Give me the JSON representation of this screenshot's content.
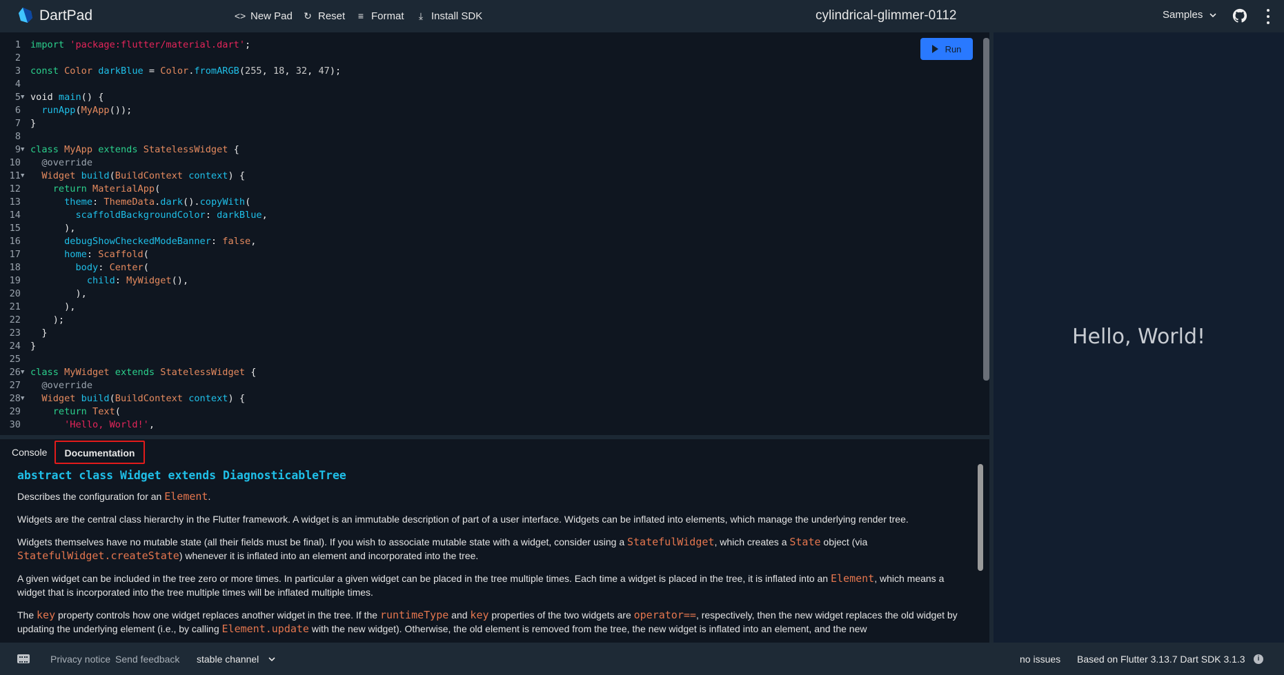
{
  "header": {
    "brand": "DartPad",
    "actions": [
      {
        "label": "New Pad",
        "icon": "code-icon"
      },
      {
        "label": "Reset",
        "icon": "refresh-icon"
      },
      {
        "label": "Format",
        "icon": "format-align-icon"
      },
      {
        "label": "Install SDK",
        "icon": "download-icon"
      }
    ],
    "pad_title": "cylindrical-glimmer-0112",
    "samples_label": "Samples",
    "github_icon": "github-icon",
    "menu_icon": "more-vert-icon"
  },
  "editor": {
    "run_label": "Run",
    "lines": [
      {
        "n": "1",
        "fold": false,
        "tokens": [
          [
            "kw",
            "import"
          ],
          [
            "pl",
            " "
          ],
          [
            "str",
            "'package:flutter/material.dart'"
          ],
          [
            "pl",
            ";"
          ]
        ]
      },
      {
        "n": "2",
        "fold": false,
        "tokens": []
      },
      {
        "n": "3",
        "fold": false,
        "tokens": [
          [
            "kw",
            "const"
          ],
          [
            "pl",
            " "
          ],
          [
            "ty",
            "Color"
          ],
          [
            "pl",
            " "
          ],
          [
            "id",
            "darkBlue"
          ],
          [
            "pl",
            " = "
          ],
          [
            "ty",
            "Color"
          ],
          [
            "pl",
            "."
          ],
          [
            "id",
            "fromARGB"
          ],
          [
            "pl",
            "("
          ],
          [
            "num",
            "255"
          ],
          [
            "pl",
            ", "
          ],
          [
            "num",
            "18"
          ],
          [
            "pl",
            ", "
          ],
          [
            "num",
            "32"
          ],
          [
            "pl",
            ", "
          ],
          [
            "num",
            "47"
          ],
          [
            "pl",
            ");"
          ]
        ]
      },
      {
        "n": "4",
        "fold": false,
        "tokens": []
      },
      {
        "n": "5",
        "fold": true,
        "tokens": [
          [
            "pl",
            "void "
          ],
          [
            "id",
            "main"
          ],
          [
            "pl",
            "() {"
          ]
        ]
      },
      {
        "n": "6",
        "fold": false,
        "tokens": [
          [
            "pl",
            "  "
          ],
          [
            "id",
            "runApp"
          ],
          [
            "pl",
            "("
          ],
          [
            "ty",
            "MyApp"
          ],
          [
            "pl",
            "());"
          ]
        ]
      },
      {
        "n": "7",
        "fold": false,
        "tokens": [
          [
            "pl",
            "}"
          ]
        ]
      },
      {
        "n": "8",
        "fold": false,
        "tokens": []
      },
      {
        "n": "9",
        "fold": true,
        "tokens": [
          [
            "kw",
            "class"
          ],
          [
            "pl",
            " "
          ],
          [
            "ty",
            "MyApp"
          ],
          [
            "pl",
            " "
          ],
          [
            "kw",
            "extends"
          ],
          [
            "pl",
            " "
          ],
          [
            "ty",
            "StatelessWidget"
          ],
          [
            "pl",
            " {"
          ]
        ]
      },
      {
        "n": "10",
        "fold": false,
        "tokens": [
          [
            "pl",
            "  "
          ],
          [
            "ann",
            "@override"
          ]
        ]
      },
      {
        "n": "11",
        "fold": true,
        "tokens": [
          [
            "pl",
            "  "
          ],
          [
            "ty",
            "Widget"
          ],
          [
            "pl",
            " "
          ],
          [
            "id",
            "build"
          ],
          [
            "pl",
            "("
          ],
          [
            "ty",
            "BuildContext"
          ],
          [
            "pl",
            " "
          ],
          [
            "id",
            "context"
          ],
          [
            "pl",
            ") {"
          ]
        ]
      },
      {
        "n": "12",
        "fold": false,
        "tokens": [
          [
            "pl",
            "    "
          ],
          [
            "kw",
            "return"
          ],
          [
            "pl",
            " "
          ],
          [
            "ty",
            "MaterialApp"
          ],
          [
            "pl",
            "("
          ]
        ]
      },
      {
        "n": "13",
        "fold": false,
        "tokens": [
          [
            "pl",
            "      "
          ],
          [
            "id",
            "theme"
          ],
          [
            "pl",
            ": "
          ],
          [
            "ty",
            "ThemeData"
          ],
          [
            "pl",
            "."
          ],
          [
            "id",
            "dark"
          ],
          [
            "pl",
            "()."
          ],
          [
            "id",
            "copyWith"
          ],
          [
            "pl",
            "("
          ]
        ]
      },
      {
        "n": "14",
        "fold": false,
        "tokens": [
          [
            "pl",
            "        "
          ],
          [
            "id",
            "scaffoldBackgroundColor"
          ],
          [
            "pl",
            ": "
          ],
          [
            "id",
            "darkBlue"
          ],
          [
            "pl",
            ","
          ]
        ]
      },
      {
        "n": "15",
        "fold": false,
        "tokens": [
          [
            "pl",
            "      ),"
          ]
        ]
      },
      {
        "n": "16",
        "fold": false,
        "tokens": [
          [
            "pl",
            "      "
          ],
          [
            "id",
            "debugShowCheckedModeBanner"
          ],
          [
            "pl",
            ": "
          ],
          [
            "ty",
            "false"
          ],
          [
            "pl",
            ","
          ]
        ]
      },
      {
        "n": "17",
        "fold": false,
        "tokens": [
          [
            "pl",
            "      "
          ],
          [
            "id",
            "home"
          ],
          [
            "pl",
            ": "
          ],
          [
            "ty",
            "Scaffold"
          ],
          [
            "pl",
            "("
          ]
        ]
      },
      {
        "n": "18",
        "fold": false,
        "tokens": [
          [
            "pl",
            "        "
          ],
          [
            "id",
            "body"
          ],
          [
            "pl",
            ": "
          ],
          [
            "ty",
            "Center"
          ],
          [
            "pl",
            "("
          ]
        ]
      },
      {
        "n": "19",
        "fold": false,
        "tokens": [
          [
            "pl",
            "          "
          ],
          [
            "id",
            "child"
          ],
          [
            "pl",
            ": "
          ],
          [
            "ty",
            "MyWidget"
          ],
          [
            "pl",
            "(),"
          ]
        ]
      },
      {
        "n": "20",
        "fold": false,
        "tokens": [
          [
            "pl",
            "        ),"
          ]
        ]
      },
      {
        "n": "21",
        "fold": false,
        "tokens": [
          [
            "pl",
            "      ),"
          ]
        ]
      },
      {
        "n": "22",
        "fold": false,
        "tokens": [
          [
            "pl",
            "    );"
          ]
        ]
      },
      {
        "n": "23",
        "fold": false,
        "tokens": [
          [
            "pl",
            "  }"
          ]
        ]
      },
      {
        "n": "24",
        "fold": false,
        "tokens": [
          [
            "pl",
            "}"
          ]
        ]
      },
      {
        "n": "25",
        "fold": false,
        "tokens": []
      },
      {
        "n": "26",
        "fold": true,
        "tokens": [
          [
            "kw",
            "class"
          ],
          [
            "pl",
            " "
          ],
          [
            "ty",
            "MyWidget"
          ],
          [
            "pl",
            " "
          ],
          [
            "kw",
            "extends"
          ],
          [
            "pl",
            " "
          ],
          [
            "ty",
            "StatelessWidget"
          ],
          [
            "pl",
            " {"
          ]
        ]
      },
      {
        "n": "27",
        "fold": false,
        "tokens": [
          [
            "pl",
            "  "
          ],
          [
            "ann",
            "@override"
          ]
        ]
      },
      {
        "n": "28",
        "fold": true,
        "tokens": [
          [
            "pl",
            "  "
          ],
          [
            "ty",
            "Widget"
          ],
          [
            "pl",
            " "
          ],
          [
            "id",
            "build"
          ],
          [
            "pl",
            "("
          ],
          [
            "ty",
            "BuildContext"
          ],
          [
            "pl",
            " "
          ],
          [
            "id",
            "context"
          ],
          [
            "pl",
            ") {"
          ]
        ]
      },
      {
        "n": "29",
        "fold": false,
        "tokens": [
          [
            "pl",
            "    "
          ],
          [
            "kw",
            "return"
          ],
          [
            "pl",
            " "
          ],
          [
            "ty",
            "Text"
          ],
          [
            "pl",
            "("
          ]
        ]
      },
      {
        "n": "30",
        "fold": false,
        "tokens": [
          [
            "pl",
            "      "
          ],
          [
            "str",
            "'Hello, World!'"
          ],
          [
            "pl",
            ","
          ]
        ]
      }
    ]
  },
  "output": {
    "text": "Hello, World!"
  },
  "panel": {
    "tabs": [
      {
        "label": "Console",
        "active": false
      },
      {
        "label": "Documentation",
        "active": true
      }
    ],
    "doc": {
      "heading": "abstract class Widget extends DiagnosticableTree",
      "paragraphs": [
        [
          [
            "t",
            "Describes the configuration for an "
          ],
          [
            "c",
            "Element"
          ],
          [
            "t",
            "."
          ]
        ],
        [
          [
            "t",
            "Widgets are the central class hierarchy in the Flutter framework. A widget is an immutable description of part of a user interface. Widgets can be inflated into elements, which manage the underlying render tree."
          ]
        ],
        [
          [
            "t",
            "Widgets themselves have no mutable state (all their fields must be final). If you wish to associate mutable state with a widget, consider using a "
          ],
          [
            "c",
            "StatefulWidget"
          ],
          [
            "t",
            ", which creates a "
          ],
          [
            "c",
            "State"
          ],
          [
            "t",
            " object (via "
          ],
          [
            "c",
            "StatefulWidget.createState"
          ],
          [
            "t",
            ") whenever it is inflated into an element and incorporated into the tree."
          ]
        ],
        [
          [
            "t",
            "A given widget can be included in the tree zero or more times. In particular a given widget can be placed in the tree multiple times. Each time a widget is placed in the tree, it is inflated into an "
          ],
          [
            "c",
            "Element"
          ],
          [
            "t",
            ", which means a widget that is incorporated into the tree multiple times will be inflated multiple times."
          ]
        ],
        [
          [
            "t",
            "The "
          ],
          [
            "c",
            "key"
          ],
          [
            "t",
            " property controls how one widget replaces another widget in the tree. If the "
          ],
          [
            "c",
            "runtimeType"
          ],
          [
            "t",
            " and "
          ],
          [
            "c",
            "key"
          ],
          [
            "t",
            " properties of the two widgets are "
          ],
          [
            "c",
            "operator=="
          ],
          [
            "t",
            ", respectively, then the new widget replaces the old widget by updating the underlying element (i.e., by calling "
          ],
          [
            "c",
            "Element.update"
          ],
          [
            "t",
            " with the new widget). Otherwise, the old element is removed from the tree, the new widget is inflated into an element, and the new"
          ]
        ]
      ]
    }
  },
  "footer": {
    "keyboard_icon": "keyboard-icon",
    "privacy": "Privacy notice",
    "feedback": "Send feedback",
    "channel": "stable channel",
    "issues": "no issues",
    "version": "Based on Flutter 3.13.7 Dart SDK 3.1.3",
    "info_icon": "info-icon"
  },
  "colors": {
    "run_button": "#2979ff",
    "active_tab_outline": "#e31b1b",
    "header_bg": "#1c2834",
    "editor_bg": "#0f1620",
    "output_bg": "#121e2f"
  }
}
